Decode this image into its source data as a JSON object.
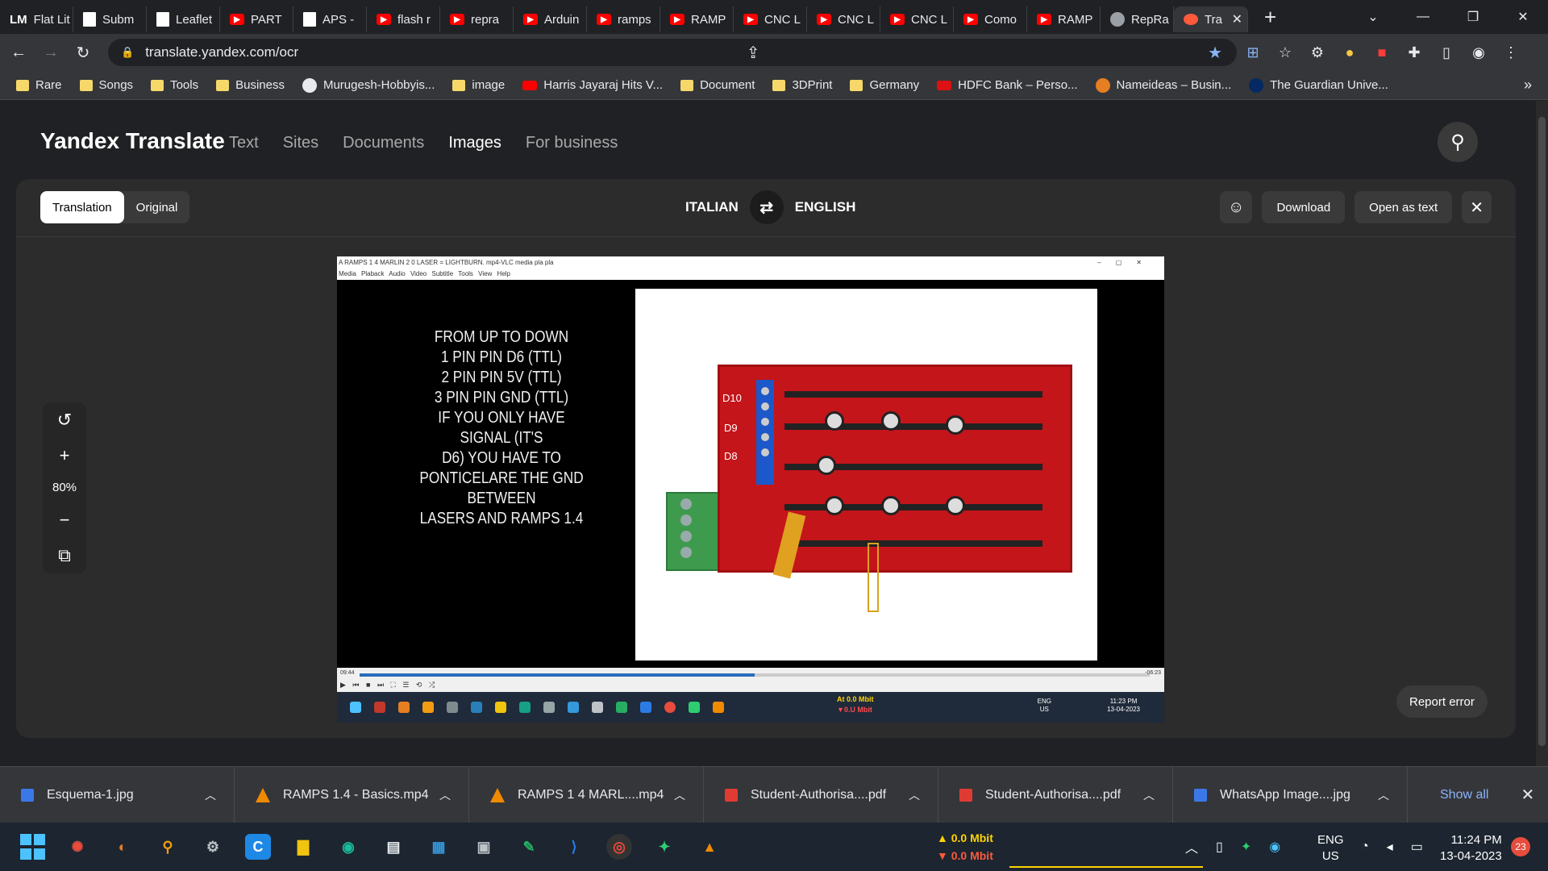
{
  "browser": {
    "tabs": [
      {
        "label": "Flat Lit",
        "icon": "lm-icon"
      },
      {
        "label": "Subm",
        "icon": "doc-icon"
      },
      {
        "label": "Leaflet",
        "icon": "doc-icon"
      },
      {
        "label": "PART",
        "icon": "youtube-icon"
      },
      {
        "label": "APS -",
        "icon": "doc-icon"
      },
      {
        "label": "flash r",
        "icon": "youtube-icon"
      },
      {
        "label": "repra",
        "icon": "youtube-icon"
      },
      {
        "label": "Arduin",
        "icon": "youtube-icon"
      },
      {
        "label": "ramps",
        "icon": "youtube-icon"
      },
      {
        "label": "RAMP",
        "icon": "youtube-icon"
      },
      {
        "label": "CNC L",
        "icon": "youtube-icon"
      },
      {
        "label": "CNC L",
        "icon": "youtube-icon"
      },
      {
        "label": "CNC L",
        "icon": "youtube-icon"
      },
      {
        "label": "Como",
        "icon": "youtube-icon"
      },
      {
        "label": "RAMP",
        "icon": "youtube-icon"
      },
      {
        "label": "RepRa",
        "icon": "globe-icon"
      },
      {
        "label": "Tra",
        "icon": "yandex-icon",
        "active": true
      }
    ],
    "url": "translate.yandex.com/ocr",
    "bookmarks": [
      {
        "label": "Rare",
        "icon": "folder-icon"
      },
      {
        "label": "Songs",
        "icon": "folder-icon"
      },
      {
        "label": "Tools",
        "icon": "folder-icon"
      },
      {
        "label": "Business",
        "icon": "folder-icon"
      },
      {
        "label": "Murugesh-Hobbyis...",
        "icon": "github-icon"
      },
      {
        "label": "image",
        "icon": "folder-icon"
      },
      {
        "label": "Harris Jayaraj Hits V...",
        "icon": "youtube-icon"
      },
      {
        "label": "Document",
        "icon": "folder-icon"
      },
      {
        "label": "3DPrint",
        "icon": "folder-icon"
      },
      {
        "label": "Germany",
        "icon": "folder-icon"
      },
      {
        "label": "HDFC Bank – Perso...",
        "icon": "hdfc-icon"
      },
      {
        "label": "Nameideas – Busin...",
        "icon": "nameideas-icon"
      },
      {
        "label": "The Guardian Unive...",
        "icon": "guardian-icon"
      }
    ],
    "bookmarks_more": "»"
  },
  "yandex": {
    "brand": "Yandex Translate",
    "nav": [
      "Text",
      "Sites",
      "Documents",
      "Images",
      "For business"
    ],
    "active_nav": "Images",
    "seg": {
      "translation": "Translation",
      "original": "Original"
    },
    "source_lang": "ITALIAN",
    "target_lang": "ENGLISH",
    "actions": {
      "download": "Download",
      "open_as_text": "Open as text"
    },
    "zoom_level": "80%",
    "report_error": "Report error"
  },
  "screenshot": {
    "window_title": "A RAMPS 1 4 MARLIN 2 0 LASER = LIGHTBURN. mp4-VLC media pla pla",
    "menu": "Media Plaback Audio Video Subtitle Tools View Help",
    "caption_lines": [
      "FROM UP TO DOWN",
      "1 PIN PIN D6 (TTL)",
      "2 PIN PIN 5V (TTL)",
      "3 PIN PIN GND (TTL)",
      "IF YOU ONLY HAVE SIGNAL (IT'S",
      "D6) YOU HAVE TO",
      "PONTICELARE THE GND BETWEEN",
      "LASERS AND RAMPS 1.4"
    ],
    "pin_labels": [
      "D10",
      "D9",
      "D8"
    ],
    "time_left": "09:44",
    "time_right": "-06:23",
    "progress": 0.5,
    "net_up": "At 0.0 Mbit",
    "net_down": "▼0.U Mbit",
    "lang": "ENG\nUS",
    "clock": "11:23 PM\n13-04-2023"
  },
  "downloads": [
    {
      "name": "Esquema-1.jpg",
      "type": "img"
    },
    {
      "name": "RAMPS 1.4 - Basics.mp4",
      "type": "vlc"
    },
    {
      "name": "RAMPS 1 4 MARL....mp4",
      "type": "vlc"
    },
    {
      "name": "Student-Authorisa....pdf",
      "type": "pdf"
    },
    {
      "name": "Student-Authorisa....pdf",
      "type": "pdf"
    },
    {
      "name": "WhatsApp Image....jpg",
      "type": "img"
    }
  ],
  "downloads_show_all": "Show all",
  "taskbar": {
    "net_up": "▲ 0.0 Mbit",
    "net_down": "▼ 0.0 Mbit",
    "lang1": "ENG",
    "lang2": "US",
    "time": "11:24 PM",
    "date": "13-04-2023",
    "notifications": "23"
  }
}
